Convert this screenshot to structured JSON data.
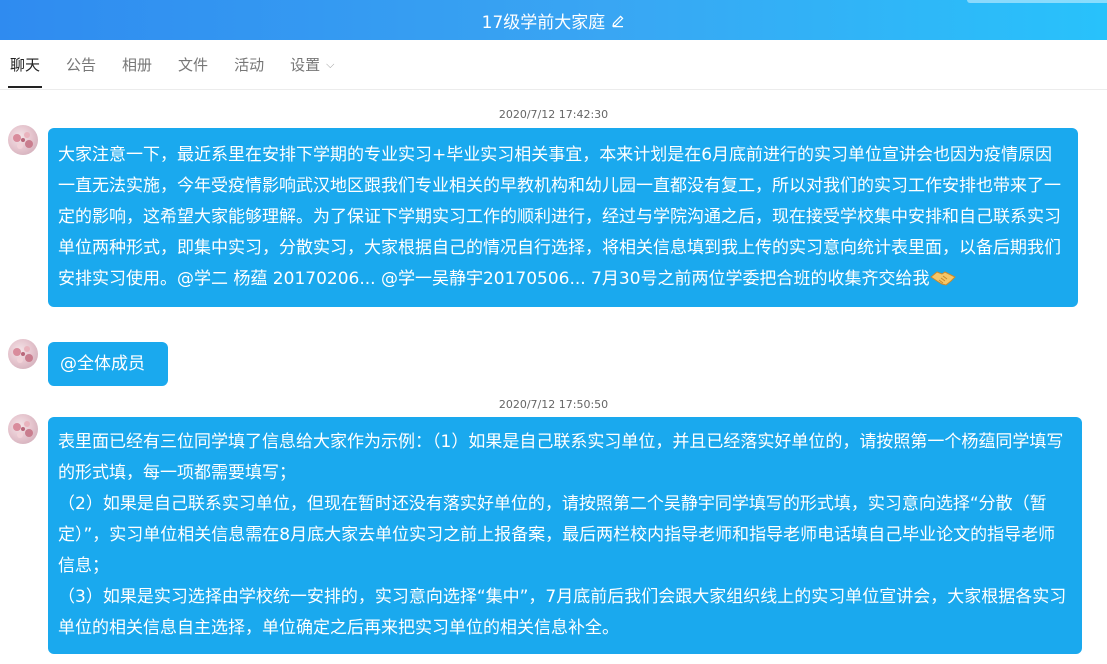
{
  "window": {
    "title": "17级学前大家庭"
  },
  "tabs": [
    {
      "label": "聊天"
    },
    {
      "label": "公告"
    },
    {
      "label": "相册"
    },
    {
      "label": "文件"
    },
    {
      "label": "活动"
    },
    {
      "label": "设置"
    }
  ],
  "messages": [
    {
      "timestamp": "2020/7/12 17:42:30",
      "text": "大家注意一下，最近系里在安排下学期的专业实习+毕业实习相关事宜，本来计划是在6月底前进行的实习单位宣讲会也因为疫情原因一直无法实施，今年受疫情影响武汉地区跟我们专业相关的早教机构和幼儿园一直都没有复工，所以对我们的实习工作安排也带来了一定的影响，这希望大家能够理解。为了保证下学期实习工作的顺利进行，经过与学院沟通之后，现在接受学校集中安排和自己联系实习单位两种形式，即集中实习，分散实习，大家根据自己的情况自行选择，将相关信息填到我上传的实习意向统计表里面，以备后期我们安排实习使用。@学二  杨蕴 20170206... @学一吴静宇20170506... 7月30号之前两位学委把合班的收集齐交给我"
    },
    {
      "text": "@全体成员"
    },
    {
      "timestamp": "2020/7/12 17:50:50",
      "lines": [
        "表里面已经有三位同学填了信息给大家作为示例：（1）如果是自己联系实习单位，并且已经落实好单位的，请按照第一个杨蕴同学填写的形式填，每一项都需要填写；",
        "（2）如果是自己联系实习单位，但现在暂时还没有落实好单位的，请按照第二个吴静宇同学填写的形式填，实习意向选择“分散（暂定）”，实习单位相关信息需在8月底大家去单位实习之前上报备案，最后两栏校内指导老师和指导老师电话填自己毕业论文的指导老师信息；",
        "（3）如果是实习选择由学校统一安排的，实习意向选择“集中”，7月底前后我们会跟大家组织线上的实习单位宣讲会，大家根据各实习单位的相关信息自主选择，单位确定之后再来把实习单位的相关信息补全。"
      ]
    }
  ],
  "colors": {
    "bubble": "#1aa9ee",
    "header_start": "#2f8bf0",
    "header_end": "#28c2fb"
  }
}
